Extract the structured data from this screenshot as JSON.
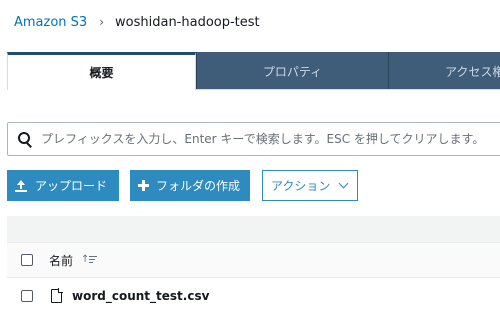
{
  "breadcrumb": {
    "root": "Amazon S3",
    "separator": "›",
    "current": "woshidan-hadoop-test"
  },
  "tabs": [
    {
      "label": "概要",
      "active": true
    },
    {
      "label": "プロパティ",
      "active": false
    },
    {
      "label": "アクセス権",
      "active": false
    }
  ],
  "search": {
    "placeholder": "プレフィックスを入力し、Enter キーで検索します。ESC を押してクリアします。",
    "value": ""
  },
  "toolbar": {
    "upload_label": "アップロード",
    "create_folder_label": "フォルダの作成",
    "actions_label": "アクション"
  },
  "table": {
    "columns": [
      {
        "label": "名前",
        "sort": "ascending"
      }
    ],
    "rows": [
      {
        "name": "word_count_test.csv",
        "type": "file"
      }
    ]
  },
  "colors": {
    "link": "#0073bb",
    "tab_inactive_bg": "#3f5d79",
    "button_primary": "#2e8bc0"
  }
}
